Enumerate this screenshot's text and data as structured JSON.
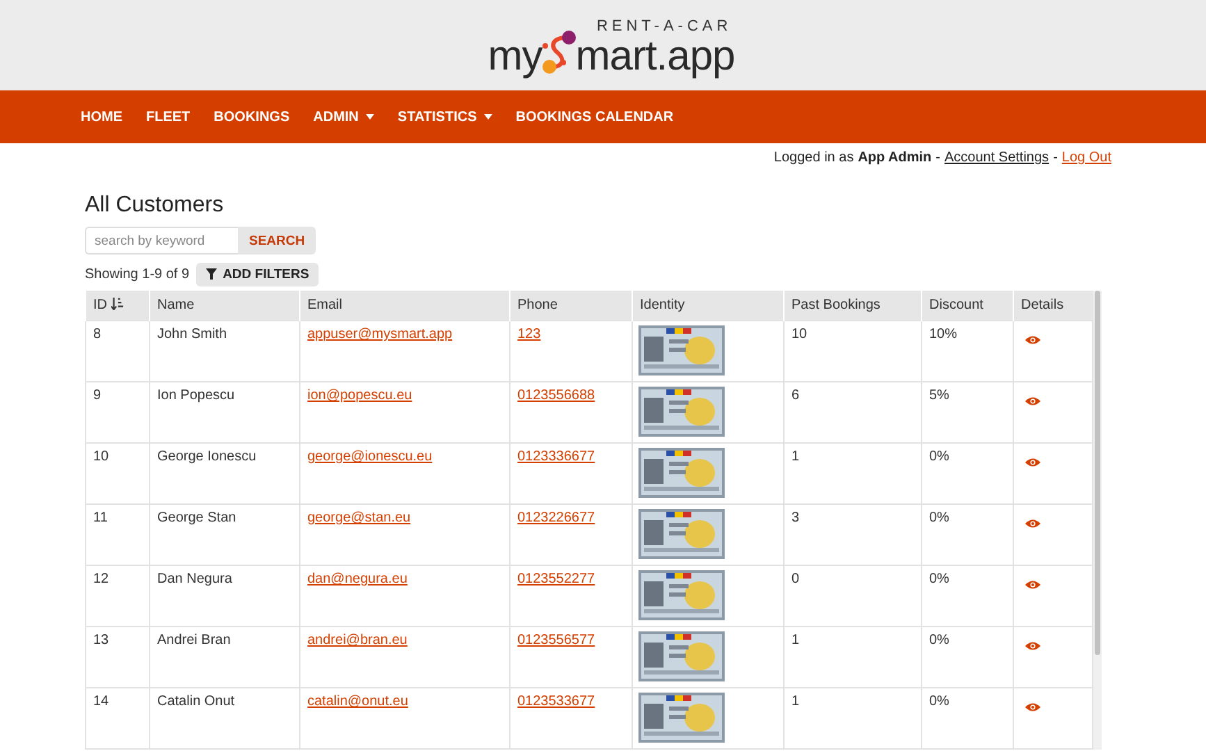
{
  "logo": {
    "tagline": "RENT-A-CAR",
    "left": "my",
    "right": "mart.app"
  },
  "nav": [
    {
      "label": "HOME",
      "has_menu": false
    },
    {
      "label": "FLEET",
      "has_menu": false
    },
    {
      "label": "BOOKINGS",
      "has_menu": false
    },
    {
      "label": "ADMIN",
      "has_menu": true
    },
    {
      "label": "STATISTICS",
      "has_menu": true
    },
    {
      "label": "BOOKINGS CALENDAR",
      "has_menu": false
    }
  ],
  "user_bar": {
    "prefix": "Logged in as",
    "user": "App Admin",
    "separator": "-",
    "account_link": "Account Settings",
    "separator_2": "-",
    "logout_link": "Log Out"
  },
  "page_title": "All Customers",
  "search": {
    "placeholder": "search by keyword",
    "button": "SEARCH"
  },
  "showing": "Showing 1-9 of 9",
  "filters_button": "ADD FILTERS",
  "table": {
    "columns": [
      "ID",
      "Name",
      "Email",
      "Phone",
      "Identity",
      "Past Bookings",
      "Discount",
      "Details"
    ],
    "rows": [
      {
        "id": "8",
        "name": "John Smith",
        "email": "appuser@mysmart.app",
        "phone": "123",
        "past_bookings": "10",
        "discount": "10%"
      },
      {
        "id": "9",
        "name": "Ion Popescu",
        "email": "ion@popescu.eu",
        "phone": "0123556688",
        "past_bookings": "6",
        "discount": "5%"
      },
      {
        "id": "10",
        "name": "George Ionescu",
        "email": "george@ionescu.eu",
        "phone": "0123336677",
        "past_bookings": "1",
        "discount": "0%"
      },
      {
        "id": "11",
        "name": "George Stan",
        "email": "george@stan.eu",
        "phone": "0123226677",
        "past_bookings": "3",
        "discount": "0%"
      },
      {
        "id": "12",
        "name": "Dan Negura",
        "email": "dan@negura.eu",
        "phone": "0123552277",
        "past_bookings": "0",
        "discount": "0%"
      },
      {
        "id": "13",
        "name": "Andrei Bran",
        "email": "andrei@bran.eu",
        "phone": "0123556577",
        "past_bookings": "1",
        "discount": "0%"
      },
      {
        "id": "14",
        "name": "Catalin Onut",
        "email": "catalin@onut.eu",
        "phone": "0123533677",
        "past_bookings": "1",
        "discount": "0%"
      }
    ]
  }
}
